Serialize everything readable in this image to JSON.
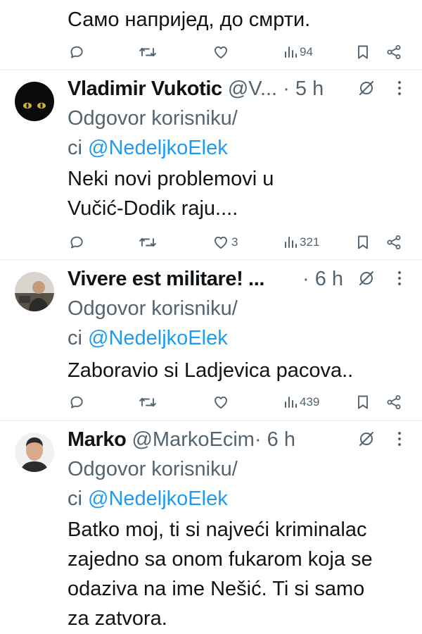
{
  "top_tweet": {
    "text_line": "Само напријед, до смрти.",
    "views": "94"
  },
  "replies": [
    {
      "name": "Vladimir Vukotic",
      "handle": "@V...",
      "time": "· 5 h",
      "reply_label_1": "Odgovor korisniku/",
      "reply_label_2": "ci ",
      "reply_target": "@NedeljkoElek",
      "text_lines": [
        "Neki novi problemovi u",
        "Vučić-Dodik raju...."
      ],
      "likes": "3",
      "views": "321"
    },
    {
      "name": "Vivere est militare! ...",
      "handle": "",
      "time": "· 6 h",
      "reply_label_1": "Odgovor korisniku/",
      "reply_label_2": "ci ",
      "reply_target": "@NedeljkoElek",
      "text_lines": [
        "Zaboravio si Ladjevica pacova.."
      ],
      "likes": "",
      "views": "439"
    },
    {
      "name": "Marko",
      "handle": "@MarkoEcim",
      "time": "· 6 h",
      "reply_label_1": "Odgovor korisniku/",
      "reply_label_2": "ci ",
      "reply_target": "@NedeljkoElek",
      "text_lines": [
        "Batko moj, ti si najveći kriminalac",
        "zajedno sa onom fukarom koja se",
        "odaziva na ime Nešić. Ti si samo",
        "za zatvora."
      ]
    }
  ],
  "icons": {
    "reply": "reply-icon",
    "retweet": "retweet-icon",
    "like": "heart-icon",
    "views": "views-icon",
    "bookmark": "bookmark-icon",
    "share": "share-icon",
    "grok": "grok-icon",
    "more": "more-options-icon"
  },
  "colors": {
    "text": "#0f1419",
    "secondary": "#536471",
    "link": "#1d9bf0",
    "divider": "#eff3f4"
  }
}
